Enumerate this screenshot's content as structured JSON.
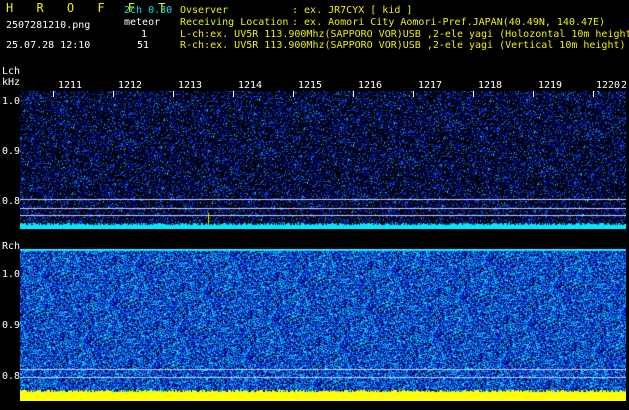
{
  "app": {
    "title": "H R O F F T",
    "filename": "2507281210.png",
    "datetime": "25.07.28 12:10"
  },
  "channels_info": {
    "mode": "2ch 0.30",
    "meteor_label": "meteor",
    "lch_count": "1",
    "rch_count": "51"
  },
  "header": {
    "observer_label": "Ovserver",
    "observer_value": ": ex. JR7CYX [ kid ]",
    "location_label": "Receiving Location",
    "location_value": ": ex. Aomori City Aomori-Pref.JAPAN(40.49N, 140.47E)",
    "lch_line": "L-ch:ex. UV5R 113.900Mhz(SAPPORO VOR)USB ,2-ele yagi (Holozontal 10m height",
    "rch_line": "R-ch:ex. UV5R 113.900Mhz(SAPPORO VOR)USB ,2-ele yagi (Vertical 10m height)"
  },
  "axis": {
    "lch_label": "Lch",
    "khz_label": "kHz",
    "rch_label": "Rch",
    "freq_ticks_lch": [
      "1.0",
      "0.9",
      "0.8"
    ],
    "freq_ticks_rch": [
      "1.0",
      "0.9",
      "0.8"
    ],
    "time_ticks": [
      "1211",
      "1212",
      "1213",
      "1214",
      "1215",
      "1216",
      "1217",
      "1218",
      "1219",
      "1220"
    ],
    "time_tick_trailing": "2"
  },
  "colors": {
    "cyan_text": "#00e8e8",
    "yellow_text": "#f0f000",
    "noise_floor_lch": "#00e8ff",
    "noise_floor_rch": "#ffff00",
    "background": "#000000"
  }
}
